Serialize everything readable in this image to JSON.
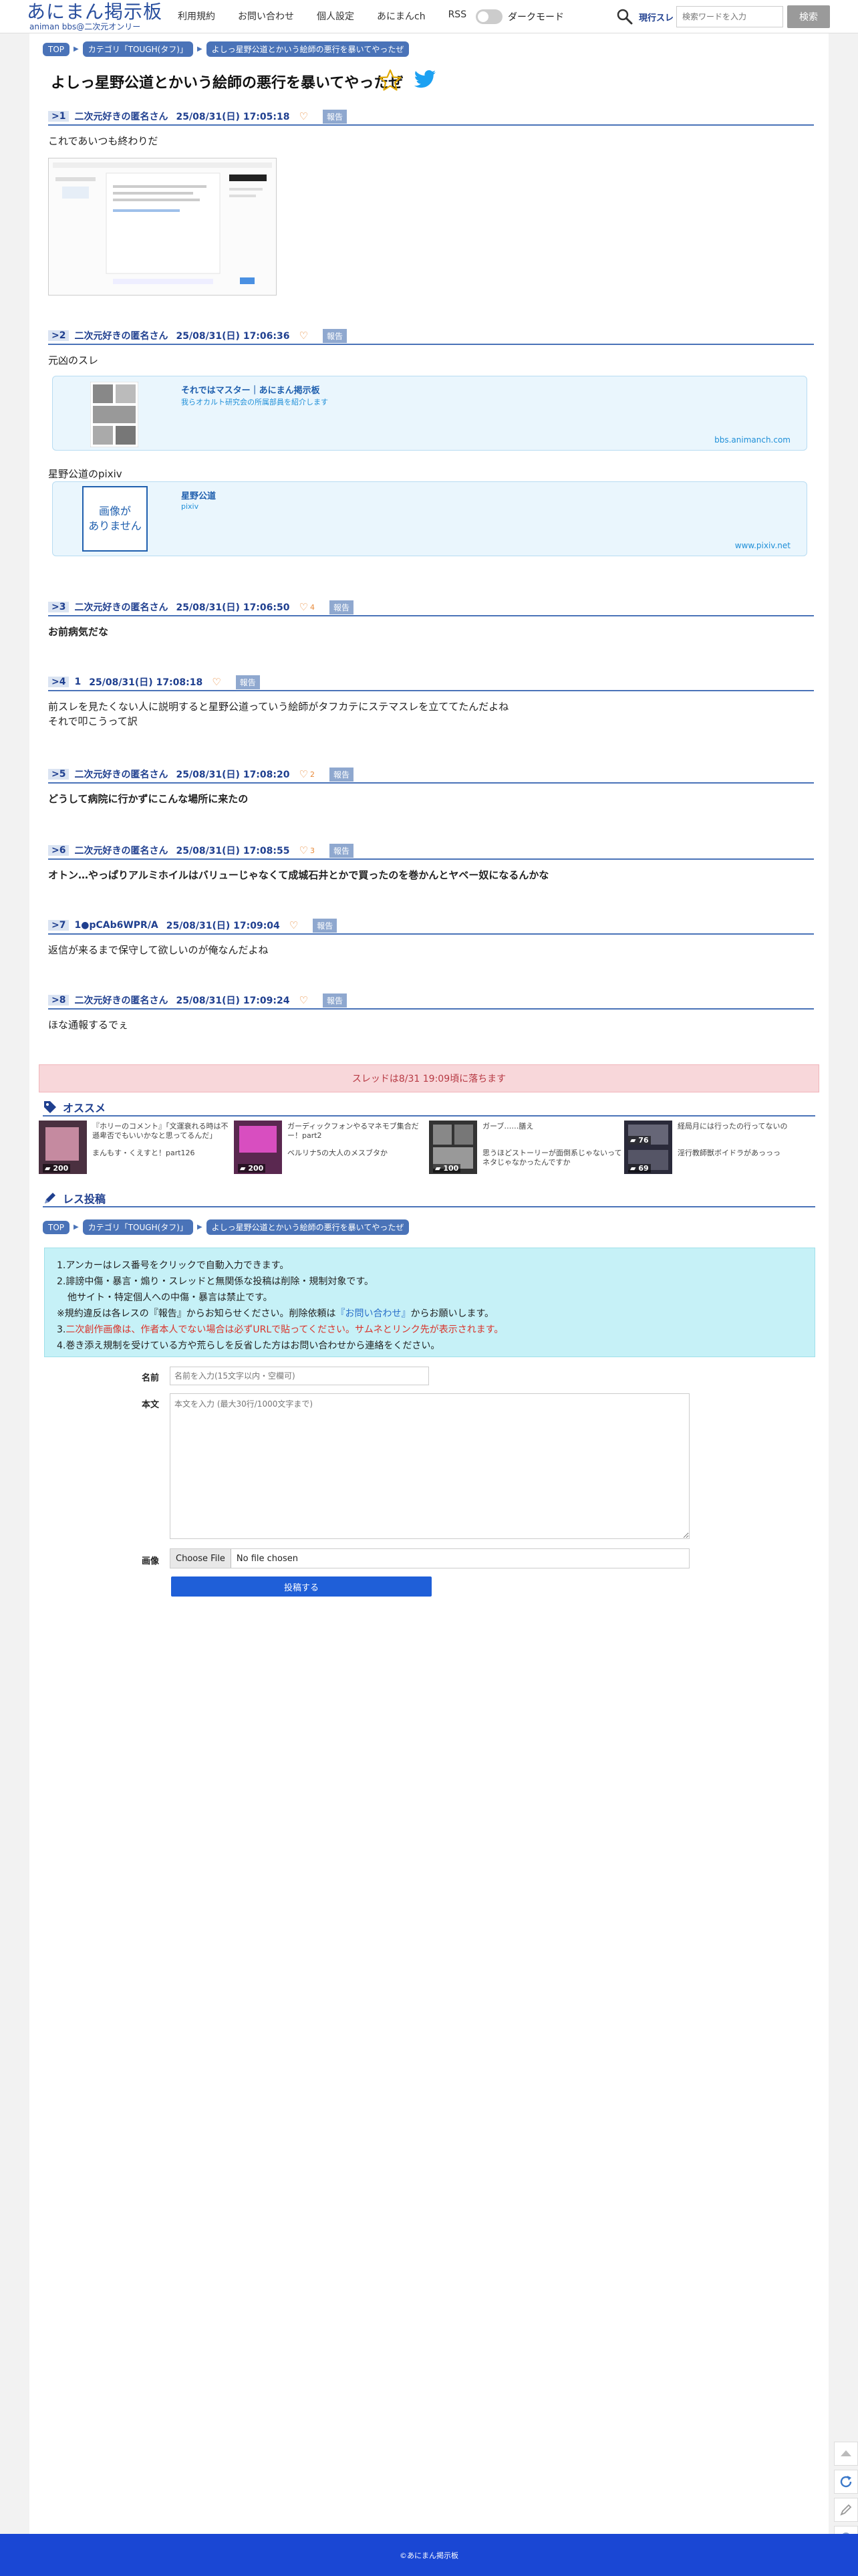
{
  "header": {
    "logo_main": "あにまん掲示板",
    "logo_sub": "animan bbs@二次元オンリー",
    "nav": [
      "利用規約",
      "お問い合わせ",
      "個人設定",
      "あにまんch",
      "RSS"
    ],
    "dark_mode_label": "ダークモード",
    "search_type": "現行スレ",
    "search_placeholder": "検索ワードを入力",
    "search_button": "検索"
  },
  "breadcrumb": {
    "top": "TOP",
    "category": "カテゴリ「TOUGH(タフ)」",
    "thread": "よしっ星野公道とかいう絵師の悪行を暴いてやったぜ"
  },
  "thread_title": "よしっ星野公道とかいう絵師の悪行を暴いてやったぜ",
  "report_label": "報告",
  "posts": [
    {
      "num": "1",
      "name": "二次元好きの匿名さん",
      "date": "25/08/31(日) 17:05:18",
      "likes": "",
      "body": "これであいつも終わりだ"
    },
    {
      "num": "2",
      "name": "二次元好きの匿名さん",
      "date": "25/08/31(日) 17:06:36",
      "likes": "",
      "body": "元凶のスレ",
      "body2": "星野公道のpixiv"
    },
    {
      "num": "3",
      "name": "二次元好きの匿名さん",
      "date": "25/08/31(日) 17:06:50",
      "likes": "4",
      "body": "お前病気だな"
    },
    {
      "num": "4",
      "name": "1",
      "date": "25/08/31(日) 17:08:18",
      "likes": "",
      "body": "前スレを見たくない人に説明すると星野公道っていう絵師がタフカテにステマスレを立ててたんだよね\nそれで叩こうって訳"
    },
    {
      "num": "5",
      "name": "二次元好きの匿名さん",
      "date": "25/08/31(日) 17:08:20",
      "likes": "2",
      "body": "どうして病院に行かずにこんな場所に来たの"
    },
    {
      "num": "6",
      "name": "二次元好きの匿名さん",
      "date": "25/08/31(日) 17:08:55",
      "likes": "3",
      "body": "オトン…やっぱりアルミホイルはバリューじゃなくて成城石井とかで買ったのを巻かんとヤベー奴になるんかな"
    },
    {
      "num": "7",
      "name": "1●pCAb6WPR/A",
      "date": "25/08/31(日) 17:09:04",
      "likes": "",
      "body": "返信が来るまで保守して欲しいのが俺なんだよね"
    },
    {
      "num": "8",
      "name": "二次元好きの匿名さん",
      "date": "25/08/31(日) 17:09:24",
      "likes": "",
      "body": "ほな通報するでぇ"
    }
  ],
  "link_cards": [
    {
      "title": "それではマスター｜あにまん掲示板",
      "desc": "我らオカルト研究会の所属部員を紹介します",
      "domain": "bbs.animanch.com"
    },
    {
      "title": "星野公道",
      "desc": "pixiv",
      "domain": "www.pixiv.net",
      "noimage": "画像が\nありません"
    }
  ],
  "expire_text": "スレッドは8/31 19:09頃に落ちます",
  "recommend": {
    "heading": "オススメ",
    "items": [
      {
        "t1": "『ホリーのコメント』「文運衰れる時は不遜卑否でもいいかなと思ってるんだ」",
        "t2": "まんもす・くえすと！part126",
        "count": "200"
      },
      {
        "t1": "ガーディックフォンやるマネモブ集合だー！part2",
        "t2": "ベルリナ5の大人のメスブタか",
        "count": "200"
      },
      {
        "t1": "ガーブ……膳え",
        "t2": "思うほどストーリーが面倒系じゃないってネタじゃなかったんですか",
        "count": "100"
      },
      {
        "t1": "経局月には行ったの行ってないの",
        "t2": "淫行教師獣ボイドラがあっっっ",
        "count": "76",
        "count2": "69"
      }
    ]
  },
  "reply_section": {
    "heading": "レス投稿",
    "notice": [
      "1.アンカーはレス番号をクリックで自動入力できます。",
      "2.誹謗中傷・暴言・煽り・スレッドと無関係な投稿は削除・規制対象です。",
      "他サイト・特定個人への中傷・暴言は禁止です。",
      "※規約違反は各レスの『報告』からお知らせください。削除依頼は",
      "『お問い合わせ』",
      "からお願いします。",
      "3.",
      "二次創作画像は、作者本人でない場合は必ずURLで貼ってください。サムネとリンク先が表示されます。",
      "4.巻き添え規制を受けている方や荒らしを反省した方はお問い合わせから連絡をください。"
    ],
    "name_label": "名前",
    "name_placeholder": "名前を入力(15文字以内・空欄可)",
    "body_label": "本文",
    "body_placeholder": "本文を入力 (最大30行/1000文字まで)",
    "image_label": "画像",
    "file_button": "Choose File",
    "file_status": "No file chosen",
    "submit": "投稿する"
  },
  "footer": "©あにまん掲示板",
  "colors": {
    "accent": "#4a73b8",
    "footer": "#1a47d4",
    "expire_bg": "#f8d7da",
    "notice_bg": "#c6f1f7"
  }
}
